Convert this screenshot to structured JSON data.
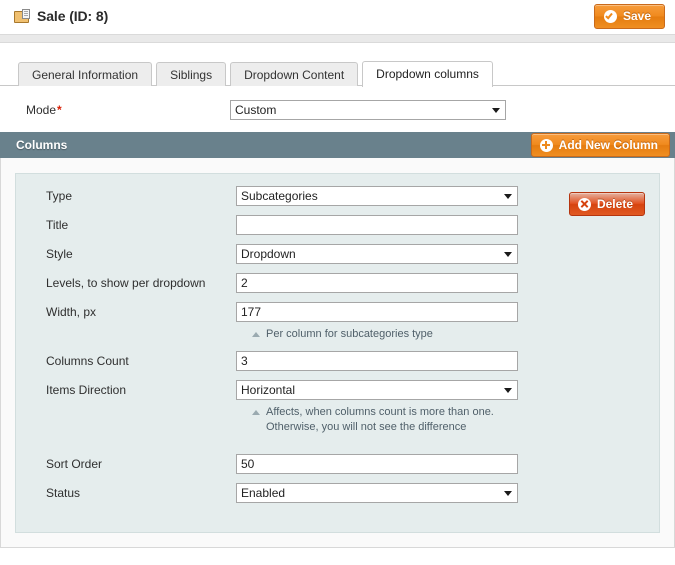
{
  "header": {
    "title": "Sale (ID: 8)",
    "icon": "window-folder-icon",
    "save_label": "Save",
    "save_icon": "check-circle-icon"
  },
  "tabs": [
    {
      "label": "General Information",
      "active": false
    },
    {
      "label": "Siblings",
      "active": false
    },
    {
      "label": "Dropdown Content",
      "active": false
    },
    {
      "label": "Dropdown columns",
      "active": true
    }
  ],
  "mode": {
    "label": "Mode",
    "required_marker": "*",
    "value": "Custom",
    "options": [
      "Custom"
    ]
  },
  "columns_panel": {
    "title": "Columns",
    "add_button_label": "Add New Column",
    "add_button_icon": "plus-circle-icon",
    "delete_button_label": "Delete",
    "delete_button_icon": "close-circle-icon",
    "accent_orange": "#ef8a1c",
    "accent_red": "#d6430f",
    "header_bg": "#69818c",
    "card_bg": "#e5eded"
  },
  "fields": {
    "type": {
      "label": "Type",
      "value": "Subcategories",
      "options": [
        "Subcategories"
      ]
    },
    "title": {
      "label": "Title",
      "value": "",
      "placeholder": ""
    },
    "style": {
      "label": "Style",
      "value": "Dropdown",
      "options": [
        "Dropdown"
      ]
    },
    "levels": {
      "label": "Levels, to show per dropdown",
      "value": "2"
    },
    "width": {
      "label": "Width, px",
      "value": "177",
      "hint": [
        "Per column for subcategories type"
      ]
    },
    "columns_count": {
      "label": "Columns Count",
      "value": "3"
    },
    "items_direction": {
      "label": "Items Direction",
      "value": "Horizontal",
      "options": [
        "Horizontal"
      ],
      "hint": [
        "Affects, when columns count is more than one.",
        "Otherwise, you will not see the difference"
      ]
    },
    "sort_order": {
      "label": "Sort Order",
      "value": "50"
    },
    "status": {
      "label": "Status",
      "value": "Enabled",
      "options": [
        "Enabled"
      ]
    }
  }
}
